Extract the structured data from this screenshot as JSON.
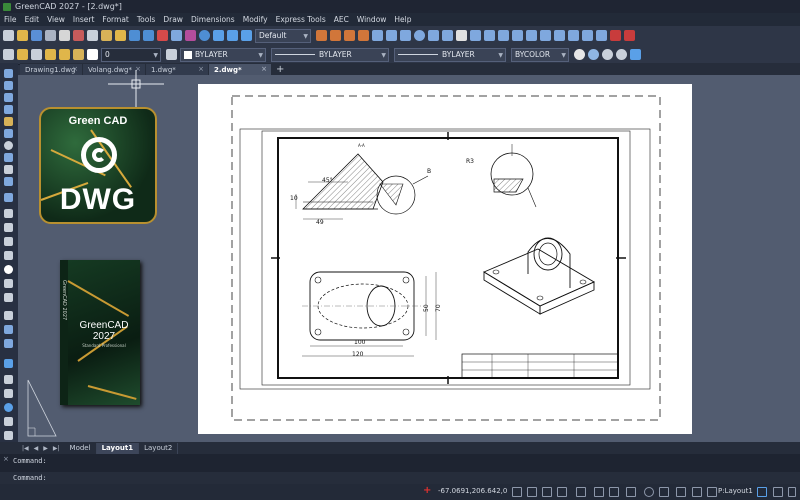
{
  "window": {
    "title": "GreenCAD 2027 - [2.dwg*]"
  },
  "menu": [
    "File",
    "Edit",
    "View",
    "Insert",
    "Format",
    "Tools",
    "Draw",
    "Dimensions",
    "Modify",
    "Express Tools",
    "AEC",
    "Window",
    "Help"
  ],
  "toolbar1": {
    "style_select": "Default"
  },
  "toolbar2": {
    "layer_select": "0",
    "color_select": "BYLAYER",
    "linetype_select": "BYLAYER",
    "lineweight_select": "BYLAYER",
    "plotstyle_select": "BYCOLOR"
  },
  "doc_tabs": [
    {
      "label": "Drawing1.dwg",
      "active": false
    },
    {
      "label": "Volang.dwg*",
      "active": false
    },
    {
      "label": "1.dwg*",
      "active": false
    },
    {
      "label": "2.dwg*",
      "active": true
    }
  ],
  "doc_tab_add": "+",
  "layout_tabs": [
    {
      "label": "Model",
      "active": false
    },
    {
      "label": "Layout1",
      "active": true
    },
    {
      "label": "Layout2",
      "active": false
    }
  ],
  "command": {
    "history_line": "Command:",
    "prompt": "Command:"
  },
  "status": {
    "coordinates": "-67.0691,206.642,0",
    "layout": "P:Layout1"
  },
  "promo": {
    "badge_brand": "Green CAD",
    "badge_format": "DWG",
    "box_name_line1": "GreenCAD",
    "box_name_line2": "2027",
    "box_edition": "Standard Professional",
    "box_side": "GreenCAD 2027"
  },
  "drawing": {
    "label_a": "A-A",
    "label_b": "B",
    "dim_angle": "45°",
    "dim_10": "10",
    "dim_49": "49",
    "dim_r3": "R3",
    "dim_100": "100",
    "dim_120": "120",
    "dim_50": "50",
    "dim_70": "70"
  },
  "colors": {
    "background": "#2b3344",
    "canvas": "#525c70",
    "accent_green": "#2f6b3c",
    "gold": "#b8902f"
  },
  "icons": [
    "new-icon",
    "open-icon",
    "save-icon",
    "print-icon",
    "undo-icon",
    "redo-icon",
    "help-icon",
    "zoom-icon",
    "layer-icon",
    "line-icon",
    "circle-icon",
    "arc-icon",
    "text-icon",
    "hatch-icon"
  ]
}
